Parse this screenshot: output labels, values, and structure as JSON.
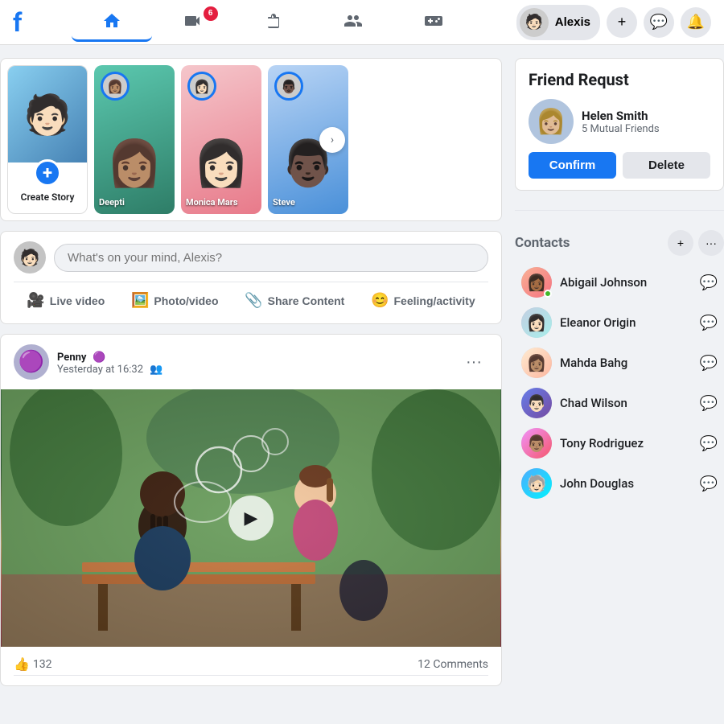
{
  "navbar": {
    "logo": "f",
    "user": "Alexis",
    "badge_count": "6",
    "add_label": "+",
    "messenger_label": "💬",
    "bell_label": "🔔"
  },
  "stories": {
    "create_label": "Create Story",
    "items": [
      {
        "name": "Deepti",
        "emoji": "👩🏽"
      },
      {
        "name": "Monica Mars",
        "emoji": "👩🏻"
      },
      {
        "name": "Steve",
        "emoji": "👨🏿"
      }
    ],
    "arrow": "›"
  },
  "post_box": {
    "placeholder": "What's on your mind, Alexis?",
    "actions": [
      {
        "label": "Live video",
        "icon": "🎥",
        "color": "#e0245e"
      },
      {
        "label": "Photo/video",
        "icon": "🖼️",
        "color": "#45bd62"
      },
      {
        "label": "Share Content",
        "icon": "📎",
        "color": "#7b68ee"
      },
      {
        "label": "Feeling/activity",
        "icon": "😊",
        "color": "#f7b928"
      }
    ]
  },
  "feed_post": {
    "author": "Penny",
    "author_badge": "🟣",
    "timestamp": "Yesterday at 16:32",
    "audience_icon": "👥",
    "more_icon": "•••",
    "likes_count": "132",
    "comments_count": "12 Comments",
    "like_icon": "👍",
    "react_icons": [
      "👍"
    ]
  },
  "friend_request": {
    "title": "Friend Requst",
    "name": "Helen Smith",
    "mutual": "5 Mutual Friends",
    "confirm_label": "Confirm",
    "delete_label": "Delete"
  },
  "contacts": {
    "title": "Contacts",
    "add_icon": "+",
    "items": [
      {
        "name": "Abigail Johnson",
        "emoji": "👩🏾",
        "color": "av1",
        "online": true
      },
      {
        "name": "Eleanor Origin",
        "emoji": "👩🏻",
        "color": "av2",
        "online": false
      },
      {
        "name": "Mahda Bahg",
        "emoji": "👩🏽",
        "color": "av3",
        "online": false
      },
      {
        "name": "Chad Wilson",
        "emoji": "👨🏻",
        "color": "av4",
        "online": false
      },
      {
        "name": "Tony Rodriguez",
        "emoji": "👨🏽",
        "color": "av5",
        "online": false
      },
      {
        "name": "John Douglas",
        "emoji": "🧓🏻",
        "color": "av6",
        "online": false
      }
    ]
  }
}
